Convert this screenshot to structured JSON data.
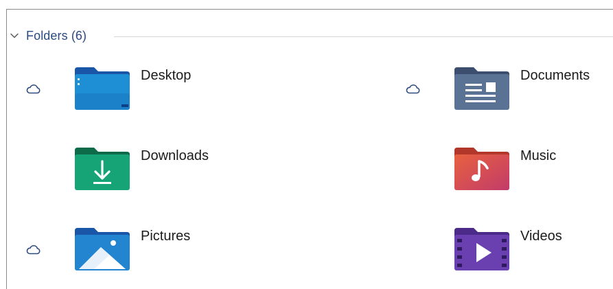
{
  "group": {
    "title": "Folders (6)",
    "expanded": true
  },
  "folders": [
    {
      "label": "Desktop",
      "icon": "desktop-folder-icon",
      "cloud": true,
      "colors": {
        "tab": "#1a56a8",
        "body": "#1e8fd4",
        "accent": "#0d3e86"
      }
    },
    {
      "label": "Documents",
      "icon": "documents-folder-icon",
      "cloud": true,
      "colors": {
        "tab": "#3b4e6e",
        "body": "#5a7294",
        "accent": "#ffffff"
      }
    },
    {
      "label": "Downloads",
      "icon": "downloads-folder-icon",
      "cloud": false,
      "colors": {
        "tab": "#0d6b4a",
        "body": "#16a477",
        "accent": "#ffffff"
      }
    },
    {
      "label": "Music",
      "icon": "music-folder-icon",
      "cloud": false,
      "colors": {
        "tab": "#b0372a",
        "body": "#e05a3f",
        "accent": "#ffffff"
      }
    },
    {
      "label": "Pictures",
      "icon": "pictures-folder-icon",
      "cloud": true,
      "colors": {
        "tab": "#1a56a8",
        "body": "#2384d0",
        "accent": "#ffffff"
      }
    },
    {
      "label": "Videos",
      "icon": "videos-folder-icon",
      "cloud": false,
      "colors": {
        "tab": "#4b2a8a",
        "body": "#6a3fb0",
        "accent": "#ffffff"
      }
    }
  ]
}
